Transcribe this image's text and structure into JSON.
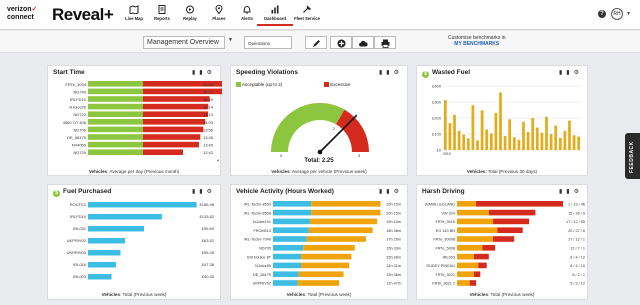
{
  "brand": {
    "vz_line1": "verizon",
    "vz_check": "✓",
    "vz_line2": "connect",
    "product": "Reveal+"
  },
  "colors": {
    "green": "#8cc63f",
    "red": "#d52b1e",
    "blue": "#3dbde3",
    "orange": "#f0a30a",
    "gold": "#e3ac1d"
  },
  "nav": [
    {
      "label": "Live Map",
      "icon": "map-icon"
    },
    {
      "label": "Reports",
      "icon": "reports-icon"
    },
    {
      "label": "Replay",
      "icon": "replay-icon"
    },
    {
      "label": "Places",
      "icon": "places-icon"
    },
    {
      "label": "Alerts",
      "icon": "alerts-icon"
    },
    {
      "label": "Dashboard",
      "icon": "dashboard-icon",
      "active": true
    },
    {
      "label": "Fleet Service",
      "icon": "fleet-service-icon"
    }
  ],
  "header": {
    "help": "?",
    "user_initials": "RH"
  },
  "toolbar": {
    "overview_value": "Management Overview",
    "ops_value": "Operations",
    "bench_line1": "Customise benchmarks in",
    "bench_link": "MY BENCHMARKS"
  },
  "feedback_label": "FEEDBACK",
  "cards": {
    "start_time": {
      "title": "Start Time",
      "footer_bold": "Vehicles",
      "footer_rest": ": Average per day (Previous month)",
      "rows": [
        {
          "label": "FRTe_3034",
          "value": "15:44"
        },
        {
          "label": "ND740",
          "value": "15:17"
        },
        {
          "label": "IRLFD10",
          "value": "14:19"
        },
        {
          "label": "NJuice26",
          "value": "14:14"
        },
        {
          "label": "ND722",
          "value": "14:13"
        },
        {
          "label": "4560 OT 406",
          "value": "14:03"
        },
        {
          "label": "ND706",
          "value": "13:56"
        },
        {
          "label": "DE_58179",
          "value": "13:45"
        },
        {
          "label": "FR4050",
          "value": "13:40"
        },
        {
          "label": "ND729",
          "value": "12:42"
        }
      ]
    },
    "speeding": {
      "title": "Speeding Violations",
      "legend_green": "Acceptable (up to 2)",
      "legend_red": "Excessive",
      "total_label": "Total: 2.25",
      "gauge_value": 2.25,
      "gauge_min": 0,
      "gauge_max": 3,
      "threshold": 2,
      "tick_min": "0",
      "tick_threshold": "2",
      "tick_max": "3",
      "footer_bold": "Vehicles",
      "footer_rest": ": Average per vehicle (Previous week)"
    },
    "wasted_fuel": {
      "title": "Wasted Fuel",
      "footer_bold": "Vehicles",
      "footer_rest": ": Total (Previous 30 days)",
      "y_ticks": [
        "£400",
        "£300",
        "£200",
        "£100",
        "£0"
      ],
      "x_label": "0910"
    },
    "fuel_purchased": {
      "title": "Fuel Purchased",
      "footer_bold": "Vehicles",
      "footer_rest": ": Total (Previous week)",
      "rows": [
        {
          "label": "ROUTE2",
          "value": "£185.48",
          "frac": 0.97
        },
        {
          "label": "IRLFD10",
          "value": "£125.82",
          "frac": 0.66
        },
        {
          "label": "IRL031",
          "value": "£95.69",
          "frac": 0.5
        },
        {
          "label": "UKPRIV02",
          "value": "£63.52",
          "frac": 0.33
        },
        {
          "label": "UKPRIV03",
          "value": "£55.45",
          "frac": 0.29
        },
        {
          "label": "IRL016",
          "value": "£47.38",
          "frac": 0.25
        },
        {
          "label": "IRL003",
          "value": "£40.45",
          "frac": 0.21
        }
      ]
    },
    "activity": {
      "title": "Vehicle Activity (Hours Worked)",
      "footer_bold": "Vehicles",
      "footer_rest": ": Total (Previous week)",
      "rows": [
        {
          "label": "IRL-Techn-8509",
          "value": "20h 10m",
          "blue": 0.34,
          "orange": 0.62
        },
        {
          "label": "IRL-Techn-8508",
          "value": "20h 15m",
          "blue": 0.34,
          "orange": 0.62
        },
        {
          "label": "NJuice101",
          "value": "19h 14m",
          "blue": 0.33,
          "orange": 0.6
        },
        {
          "label": "FROM013",
          "value": "18h 48m",
          "blue": 0.32,
          "orange": 0.57
        },
        {
          "label": "IRL-Techn-7040",
          "value": "17h 29m",
          "blue": 0.3,
          "orange": 0.53
        },
        {
          "label": "ND705",
          "value": "15h 33m",
          "blue": 0.27,
          "orange": 0.46
        },
        {
          "label": "Brit NJuice 8T",
          "value": "15h 08m",
          "blue": 0.25,
          "orange": 0.45
        },
        {
          "label": "NJuice95",
          "value": "14h 41m",
          "blue": 0.25,
          "orange": 0.43
        },
        {
          "label": "DE_58179",
          "value": "13h 36m",
          "blue": 0.23,
          "orange": 0.4
        },
        {
          "label": "UKPRIV02",
          "value": "12h 47m",
          "blue": 0.22,
          "orange": 0.37
        }
      ]
    },
    "harsh": {
      "title": "Harsh Driving",
      "footer_bold": "Vehicles",
      "footer_rest": ": Total (Previous week)",
      "rows": [
        {
          "label": "IVANN LEGLAND",
          "value": "1 / 13 / 46",
          "orange": 0.18,
          "red": 0.82
        },
        {
          "label": "VW 324",
          "value": "15 / 26 / 9",
          "orange": 0.3,
          "red": 0.44
        },
        {
          "label": "FRTe_3015",
          "value": "17 / 12 / 65",
          "orange": 0.34,
          "red": 0.34
        },
        {
          "label": "EG 143 BN",
          "value": "20 / 27 / 6",
          "orange": 0.38,
          "red": 0.24
        },
        {
          "label": "FRTe_30008",
          "value": "17 / 12 / 1",
          "orange": 0.34,
          "red": 0.2
        },
        {
          "label": "FRTe_5008",
          "value": "12 / 7 / 1",
          "orange": 0.24,
          "red": 0.12
        },
        {
          "label": "IRL003",
          "value": "6 / 4 / 12",
          "orange": 0.16,
          "red": 0.14
        },
        {
          "label": "RUDDY PINEAU",
          "value": "8 / 4 / 10",
          "orange": 0.2,
          "red": 0.08
        },
        {
          "label": "FRTe_3021",
          "value": "8 / 2 / 1",
          "orange": 0.16,
          "red": 0.06
        },
        {
          "label": "FRTe_3021 2",
          "value": "5 / 3 / 12",
          "orange": 0.12,
          "red": 0.06
        }
      ]
    }
  }
}
